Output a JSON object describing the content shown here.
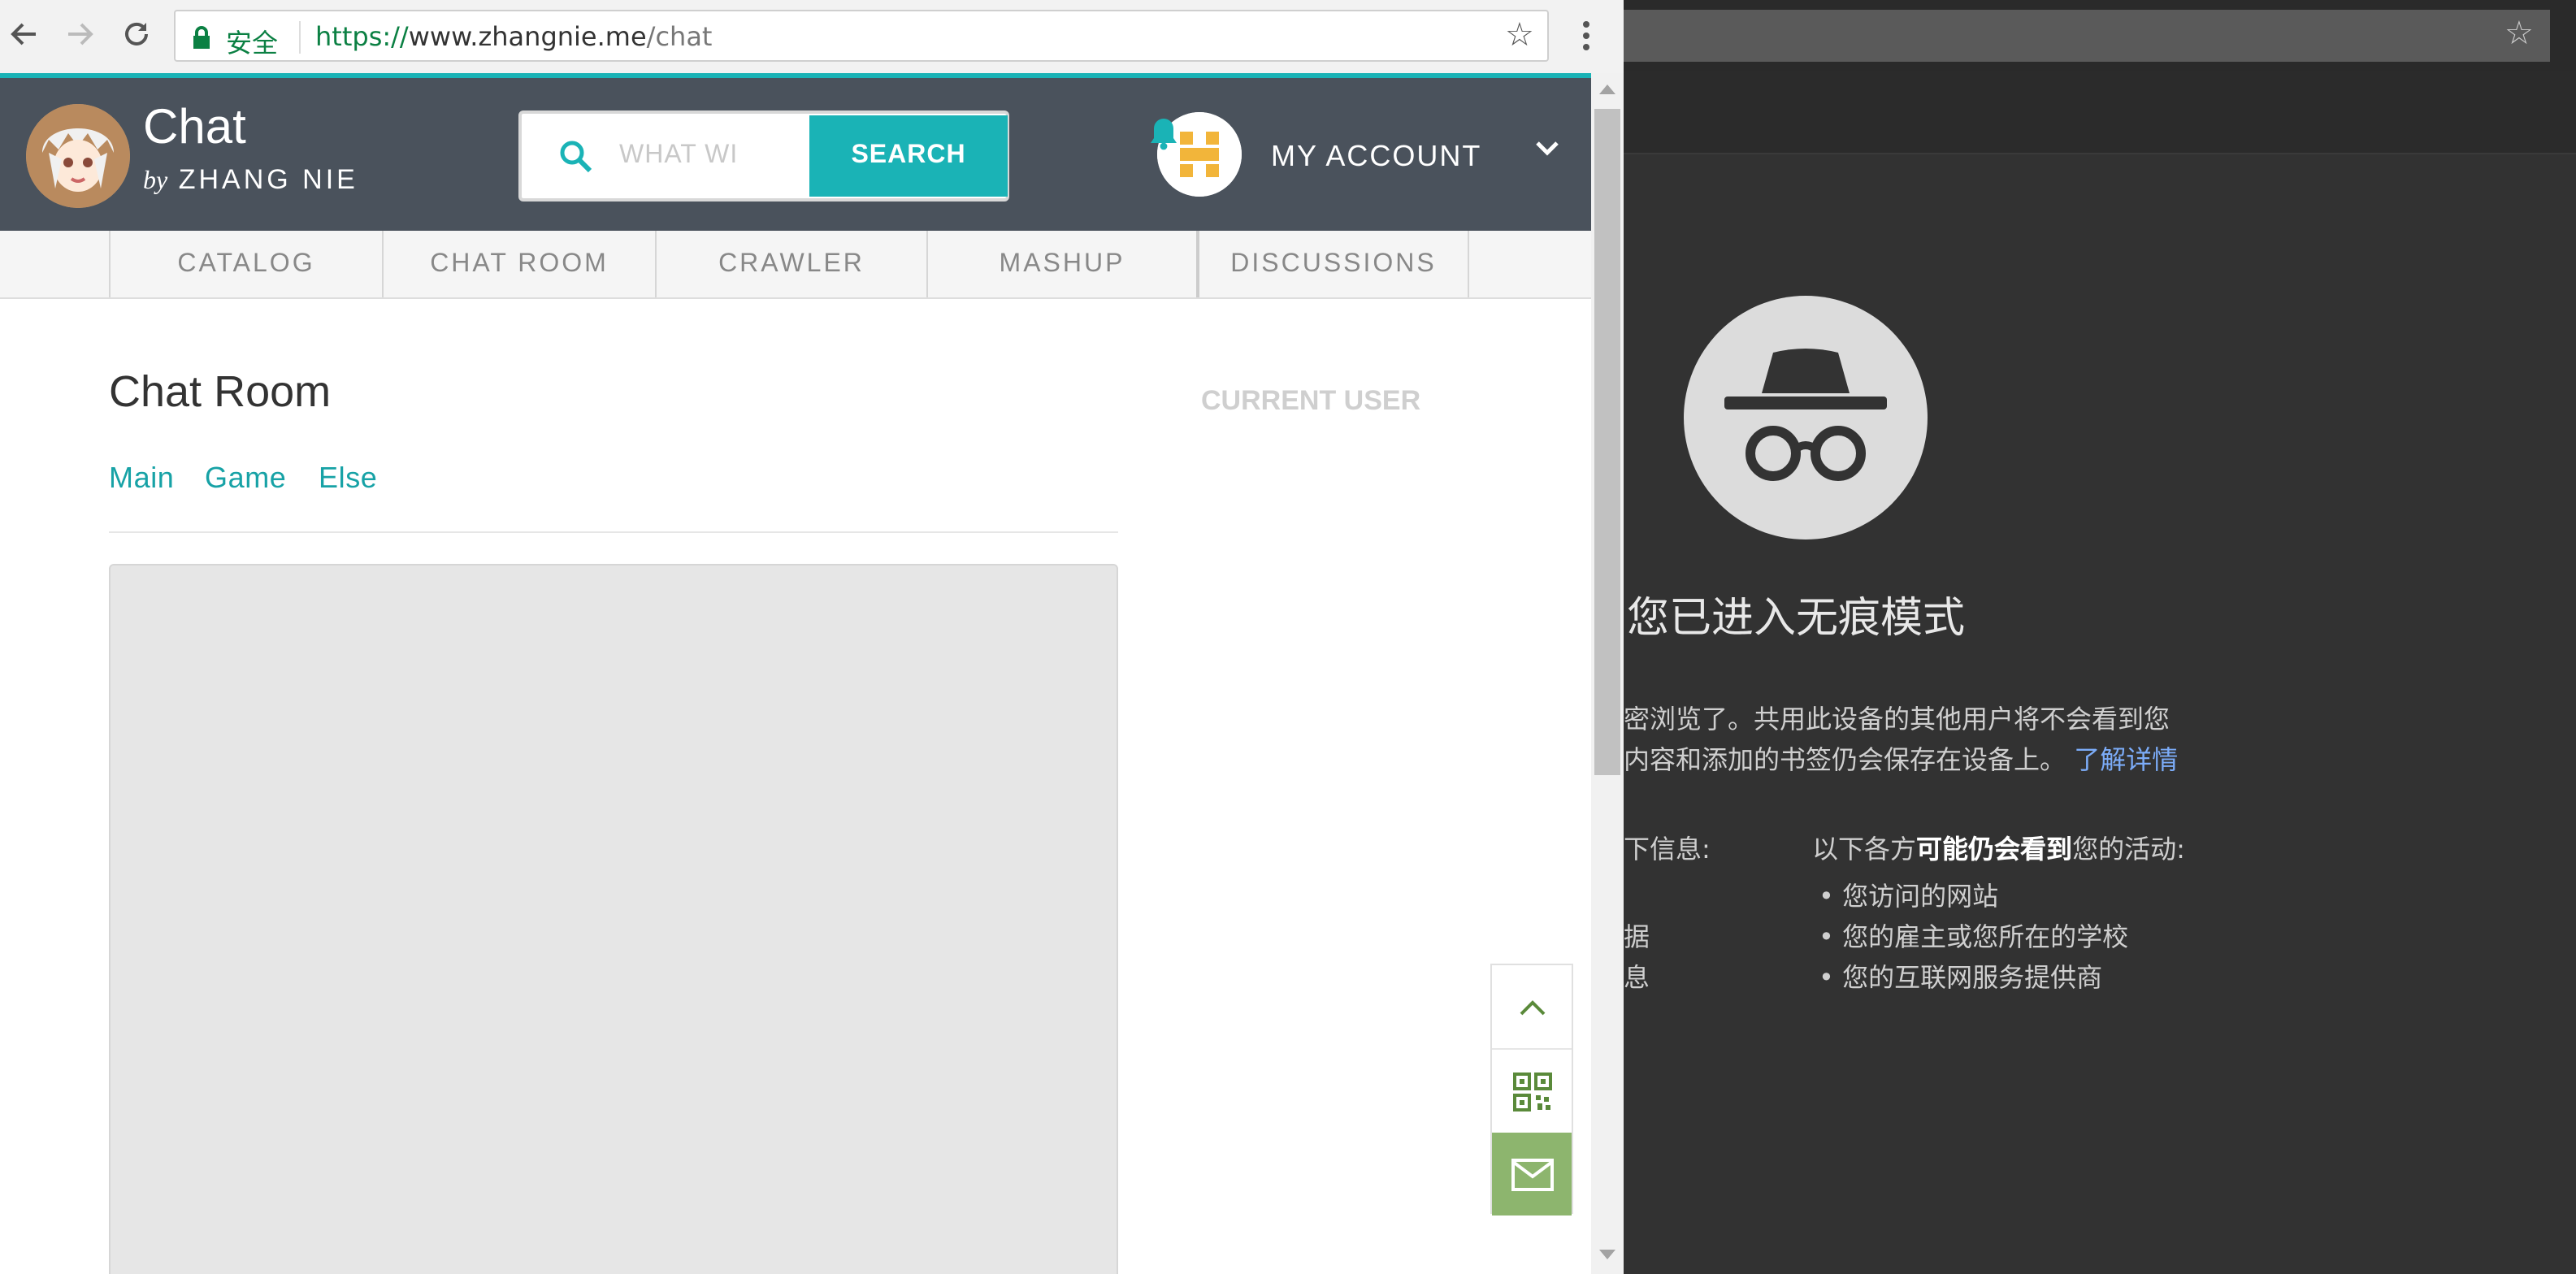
{
  "browser": {
    "secure_label": "安全",
    "url_scheme": "https://",
    "url_host": "www.zhangnie.me",
    "url_path": "/chat"
  },
  "site": {
    "title": "Chat",
    "byline_by": "by",
    "byline_name": "ZHANG NIE",
    "search_placeholder": "WHAT WI",
    "search_button": "SEARCH",
    "account_label": "MY ACCOUNT",
    "nav_tabs": [
      "CATALOG",
      "CHAT ROOM",
      "CRAWLER",
      "MASHUP",
      "DISCUSSIONS"
    ],
    "page_heading": "Chat Room",
    "room_links": [
      "Main",
      "Game",
      "Else"
    ],
    "current_user_label": "CURRENT USER"
  },
  "incognito": {
    "title": "您已进入无痕模式",
    "line1": "密浏览了。共用此设备的其他用户将不会看到您",
    "line2_text": "内容和添加的书签仍会保存在设备上。",
    "learn_more": "了解详情",
    "left_col_head": "下信息:",
    "left_col_item1": "据",
    "left_col_item2": "息",
    "right_col_head_pre": "以下各方",
    "right_col_head_bold": "可能仍会看到",
    "right_col_head_post": "您的活动:",
    "bullets": [
      "您访问的网站",
      "您的雇主或您所在的学校",
      "您的互联网服务提供商"
    ]
  },
  "colors": {
    "teal": "#1ab3b6",
    "header_bg": "#4a525c",
    "incognito_bg": "#323232"
  }
}
